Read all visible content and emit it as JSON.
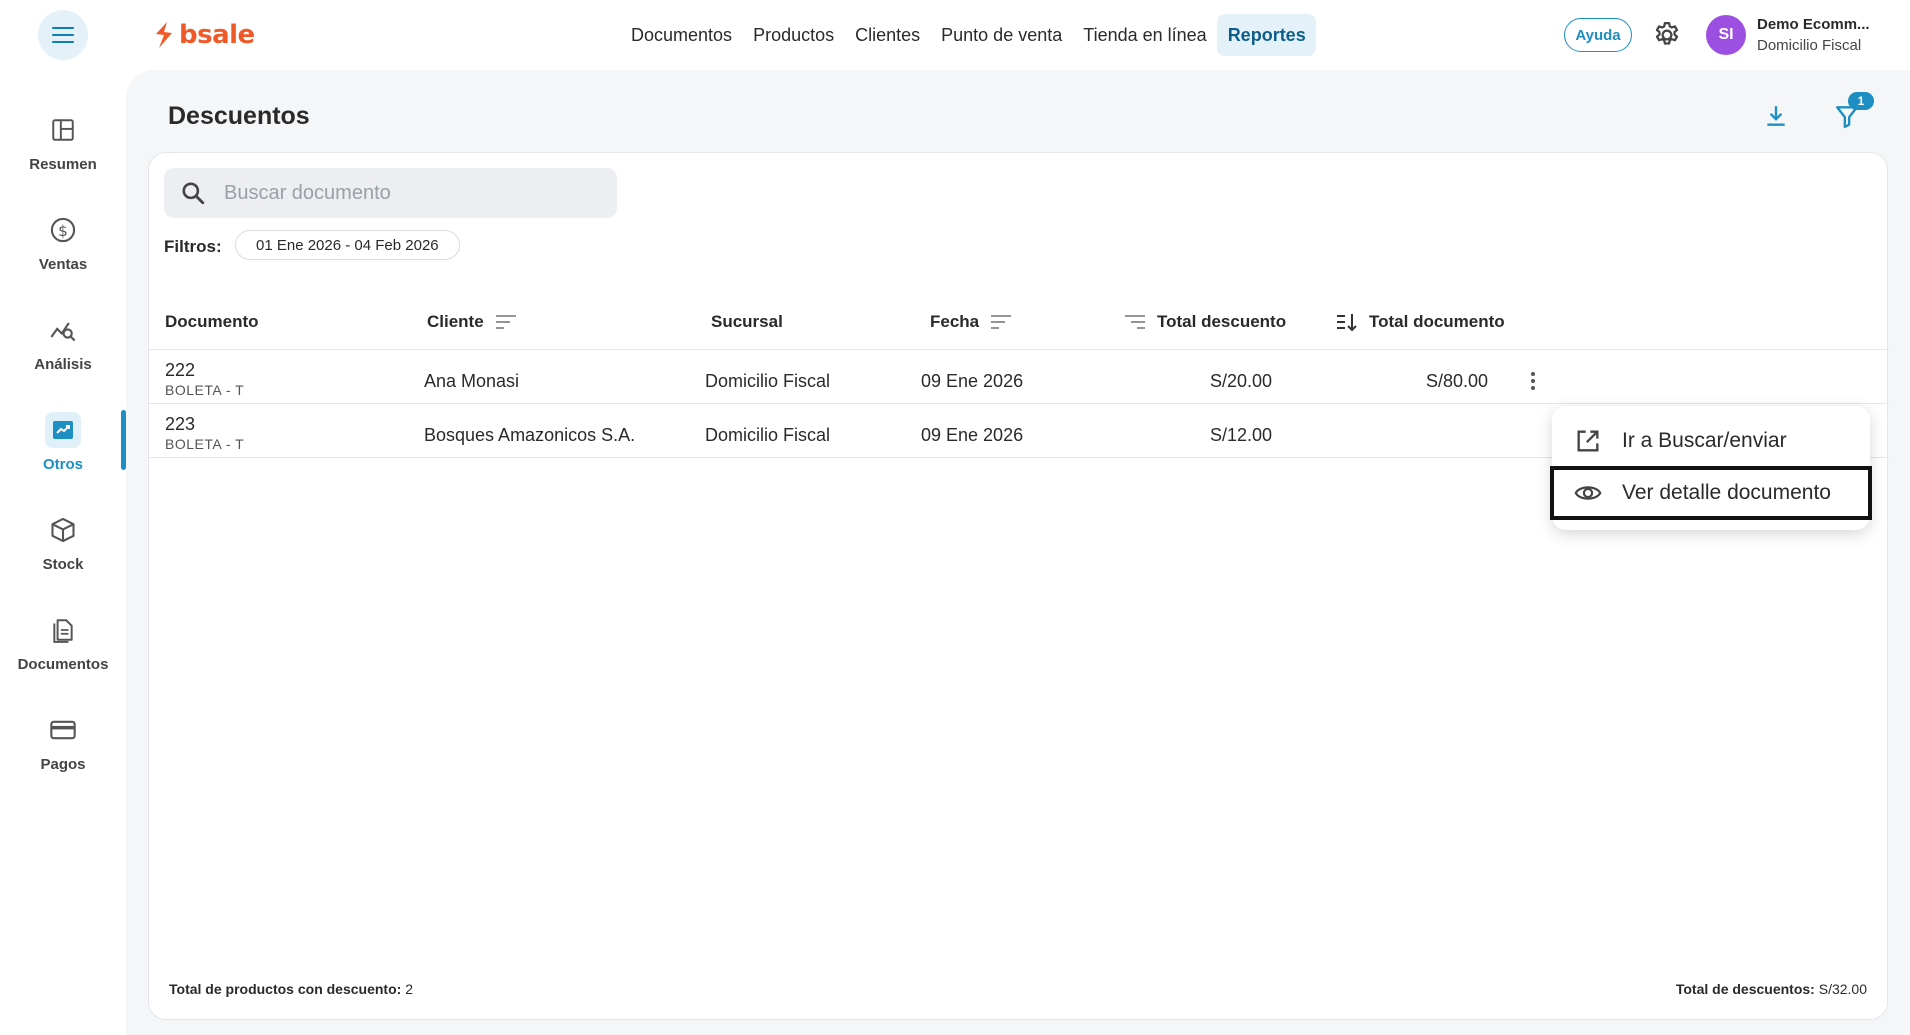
{
  "app": {
    "brand": "bsale",
    "brand_color": "#f05a28",
    "accent": "#1d8fc2"
  },
  "topnav": {
    "items": [
      {
        "label": "Documentos",
        "active": false
      },
      {
        "label": "Productos",
        "active": false
      },
      {
        "label": "Clientes",
        "active": false
      },
      {
        "label": "Punto de venta",
        "active": false
      },
      {
        "label": "Tienda en línea",
        "active": false
      },
      {
        "label": "Reportes",
        "active": true
      }
    ],
    "help_label": "Ayuda",
    "user_initials": "SI",
    "user_name": "Demo Ecomm...",
    "user_branch": "Domicilio Fiscal"
  },
  "sidebar": {
    "items": [
      {
        "label": "Resumen",
        "icon": "dashboard-icon",
        "active": false
      },
      {
        "label": "Ventas",
        "icon": "dollar-icon",
        "active": false
      },
      {
        "label": "Análisis",
        "icon": "analytics-icon",
        "active": false
      },
      {
        "label": "Otros",
        "icon": "trending-icon",
        "active": true
      },
      {
        "label": "Stock",
        "icon": "package-icon",
        "active": false
      },
      {
        "label": "Documentos",
        "icon": "document-icon",
        "active": false
      },
      {
        "label": "Pagos",
        "icon": "card-icon",
        "active": false
      }
    ]
  },
  "page": {
    "title": "Descuentos",
    "filter_count": "1",
    "search_placeholder": "Buscar documento",
    "filters_label": "Filtros:",
    "filter_chip": "01 Ene 2026 - 04 Feb 2026"
  },
  "table": {
    "columns": {
      "documento": "Documento",
      "cliente": "Cliente",
      "sucursal": "Sucursal",
      "fecha": "Fecha",
      "total_descuento": "Total descuento",
      "total_documento": "Total documento"
    },
    "rows": [
      {
        "numero": "222",
        "tipo": "BOLETA - T",
        "cliente": "Ana Monasi",
        "sucursal": "Domicilio Fiscal",
        "fecha": "09 Ene 2026",
        "total_descuento": "S/20.00",
        "total_documento": "S/80.00"
      },
      {
        "numero": "223",
        "tipo": "BOLETA - T",
        "cliente": "Bosques Amazonicos S.A.",
        "sucursal": "Domicilio Fiscal",
        "fecha": "09 Ene 2026",
        "total_descuento": "S/12.00",
        "total_documento": ""
      }
    ]
  },
  "footer": {
    "left_label": "Total de productos con descuento:",
    "left_value": " 2",
    "right_label": "Total de descuentos:",
    "right_value": " S/32.00"
  },
  "context_menu": {
    "items": [
      {
        "label": "Ir a Buscar/enviar",
        "icon": "external-link-icon"
      },
      {
        "label": "Ver detalle documento",
        "icon": "eye-icon"
      }
    ]
  }
}
